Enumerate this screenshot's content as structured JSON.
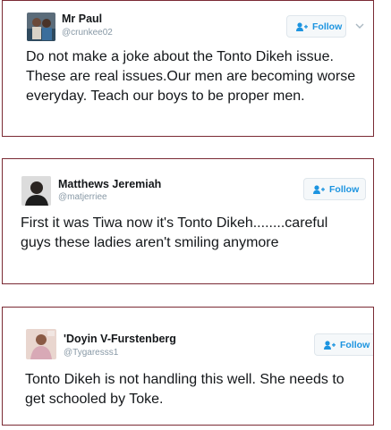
{
  "colors": {
    "card_border": "#7a2a34",
    "follow_text": "#1c94e0",
    "follow_bg": "#f5f8fa",
    "handle_text": "#8899a6",
    "tweet_text": "#14171a"
  },
  "tweets": [
    {
      "name": "Mr Paul",
      "handle": "@crunkee02",
      "follow_label": "Follow",
      "text": "Do not make a joke about the Tonto Dikeh issue. These are real issues.Our men are becoming worse everyday. Teach our boys to be proper men."
    },
    {
      "name": "Matthews Jeremiah",
      "handle": "@matjerriee",
      "follow_label": "Follow",
      "text": "First it was Tiwa now it's Tonto Dikeh........careful guys these ladies aren't smiling anymore"
    },
    {
      "name": "'Doyin V-Furstenberg",
      "handle": "@Tygaresss1",
      "follow_label": "Follow",
      "text": "Tonto Dikeh is not handling this well. She needs to get schooled by Toke."
    }
  ]
}
